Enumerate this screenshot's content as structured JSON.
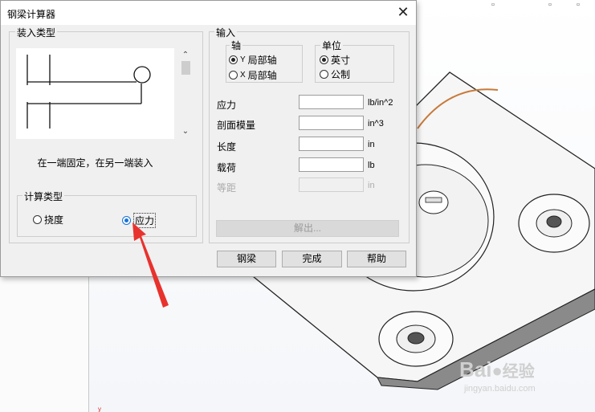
{
  "dialog": {
    "title": "钢梁计算器",
    "close_glyph": "✕"
  },
  "load_type": {
    "group_label": "装入类型",
    "caption": "在一端固定，在另一端装入"
  },
  "calc_type": {
    "group_label": "计算类型",
    "options": [
      {
        "label": "挠度",
        "checked": false
      },
      {
        "label": "应力",
        "checked": true
      }
    ]
  },
  "input": {
    "group_label": "输入",
    "axis": {
      "label": "轴",
      "options": [
        {
          "prefix": "Y",
          "label": "局部轴",
          "checked": true
        },
        {
          "prefix": "X",
          "label": "局部轴",
          "checked": false
        }
      ]
    },
    "units": {
      "label": "单位",
      "options": [
        {
          "label": "英寸",
          "checked": true
        },
        {
          "label": "公制",
          "checked": false
        }
      ]
    },
    "fields": [
      {
        "label": "应力",
        "value": "",
        "unit": "lb/in^2",
        "enabled": true
      },
      {
        "label": "剖面模量",
        "value": "",
        "unit": "in^3",
        "enabled": true
      },
      {
        "label": "长度",
        "value": "",
        "unit": "in",
        "enabled": true
      },
      {
        "label": "载荷",
        "value": "",
        "unit": "lb",
        "enabled": true
      },
      {
        "label": "等距",
        "value": "",
        "unit": "in",
        "enabled": false
      }
    ],
    "solve_label": "解出..."
  },
  "buttons": {
    "steel_beam": "钢梁",
    "done": "完成",
    "help": "帮助"
  },
  "watermark": {
    "brand": "Bai",
    "brand2": "经验",
    "url": "jingyan.baidu.com"
  },
  "colors": {
    "accent": "#1a73d9",
    "arrow": "#e8322e"
  },
  "icons": [
    "close-icon",
    "scroll-up-icon",
    "scroll-down-icon",
    "beam-diagram-icon",
    "red-arrow-annotation",
    "baidu-paw-icon"
  ]
}
